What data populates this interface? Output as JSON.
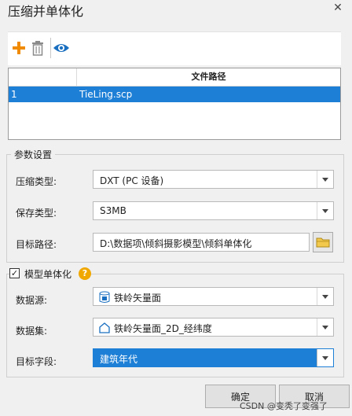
{
  "window": {
    "title": "压缩并单体化"
  },
  "toolbar": {
    "add_icon": "plus-icon",
    "delete_icon": "trash-icon",
    "view_icon": "eye-icon"
  },
  "table": {
    "columns": [
      "",
      "文件路径"
    ],
    "rows": [
      {
        "index": "1",
        "path": "TieLing.scp"
      }
    ]
  },
  "params": {
    "group_title": "参数设置",
    "compress_type_label": "压缩类型:",
    "compress_type_value": "DXT (PC 设备)",
    "save_type_label": "保存类型:",
    "save_type_value": "S3MB",
    "target_path_label": "目标路径:",
    "target_path_value": "D:\\数据项\\倾斜摄影模型\\倾斜单体化"
  },
  "model": {
    "group_title": "模型单体化",
    "checked": true,
    "datasource_label": "数据源:",
    "datasource_value": "铁岭矢量面",
    "dataset_label": "数据集:",
    "dataset_value": "铁岭矢量面_2D_经纬度",
    "field_label": "目标字段:",
    "field_value": "建筑年代"
  },
  "buttons": {
    "ok": "确定",
    "cancel": "取消"
  },
  "watermark": "CSDN @变秃了变强了",
  "colors": {
    "selection": "#1e7fd6",
    "accent_plus": "#f08a00",
    "eye": "#1a6fc0",
    "help": "#f0a800"
  }
}
